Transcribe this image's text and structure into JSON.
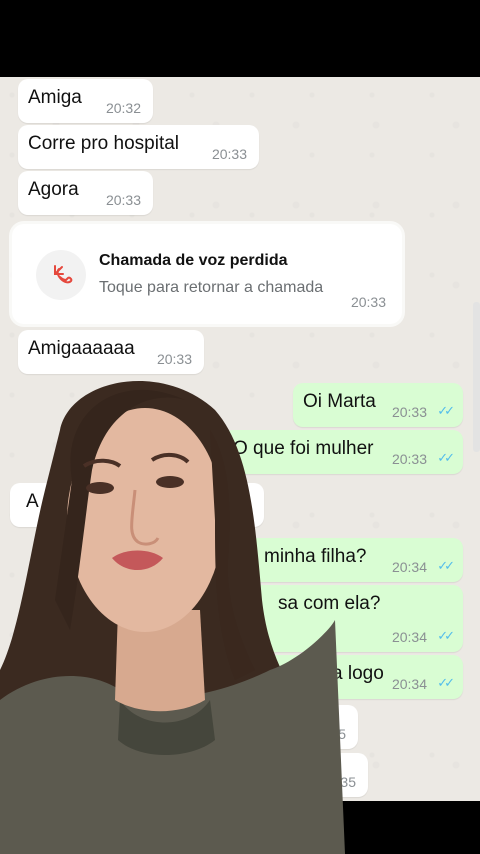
{
  "messages": {
    "in1": {
      "text": "Amiga",
      "time": "20:32"
    },
    "in2": {
      "text": "Corre pro hospital",
      "time": "20:33"
    },
    "in3": {
      "text": "Agora",
      "time": "20:33"
    },
    "missed_call": {
      "title": "Chamada de voz perdida",
      "subtitle": "Toque para retornar a chamada",
      "time": "20:33"
    },
    "in4": {
      "text": "Amigaaaaaa",
      "time": "20:33"
    },
    "out1": {
      "text": "Oi Marta",
      "time": "20:33"
    },
    "out2": {
      "text": "O que foi mulher",
      "time": "20:33"
    },
    "in5": {
      "text": "A",
      "time": "4"
    },
    "out3": {
      "text": "minha filha?",
      "time": "20:34"
    },
    "out4": {
      "text": "sa  com ela?",
      "time": "20:34"
    },
    "out5": {
      "text": "a logo",
      "time": "20:34"
    },
    "in6": {
      "time": "5"
    },
    "in7": {
      "time": "35"
    }
  },
  "colors": {
    "incoming": "#ffffff",
    "outgoing": "#d9fdd3",
    "read_ticks": "#53bdeb",
    "missed_icon": "#e5483d"
  }
}
